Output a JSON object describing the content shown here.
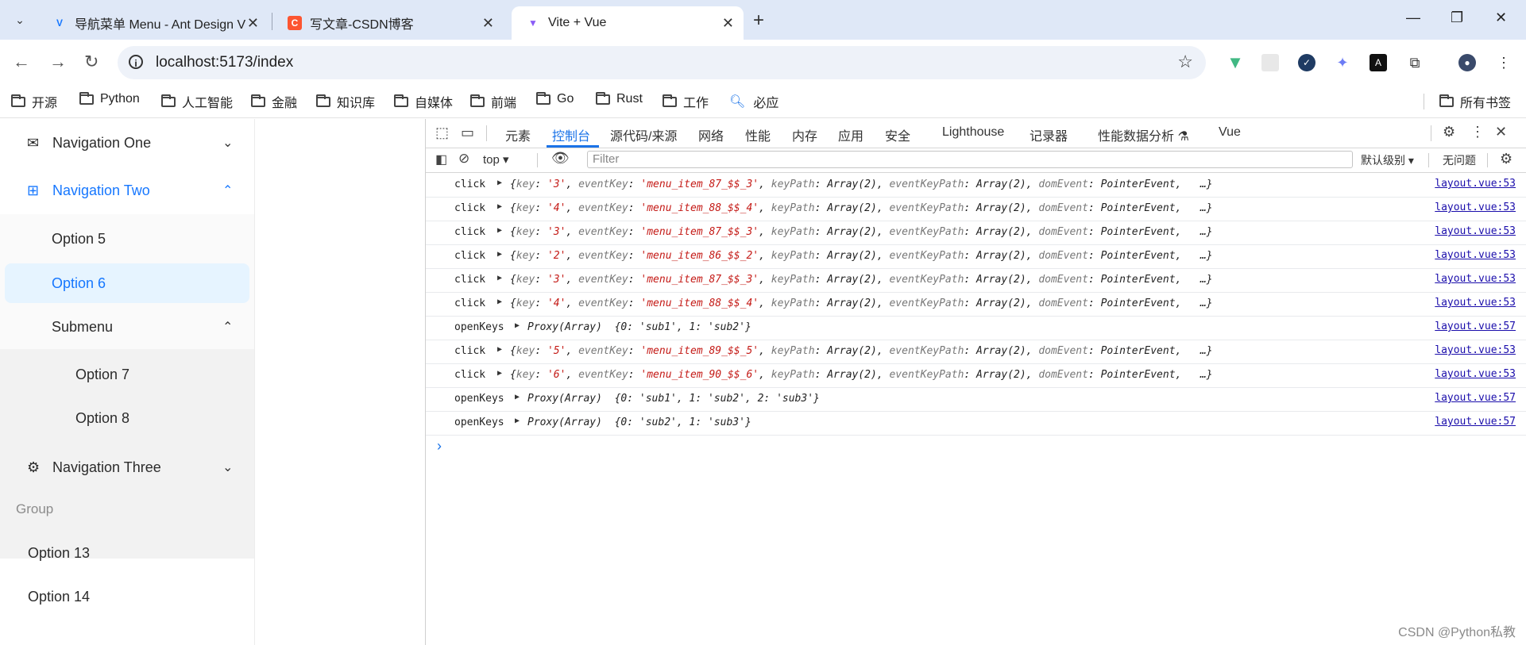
{
  "browser": {
    "tabs": [
      {
        "title": "导航菜单 Menu - Ant Design Vue",
        "active": false
      },
      {
        "title": "写文章-CSDN博客",
        "active": false
      },
      {
        "title": "Vite + Vue",
        "active": true
      }
    ],
    "url": "localhost:5173/index",
    "bookmarks": [
      "开源",
      "Python",
      "人工智能",
      "金融",
      "知识库",
      "自媒体",
      "前端",
      "Go",
      "Rust",
      "工作",
      "必应"
    ],
    "all_bookmarks": "所有书签"
  },
  "menu": {
    "nav_one": "Navigation One",
    "nav_two": "Navigation Two",
    "option5": "Option 5",
    "option6": "Option 6",
    "submenu": "Submenu",
    "option7": "Option 7",
    "option8": "Option 8",
    "nav_three": "Navigation Three",
    "group": "Group",
    "option13": "Option 13",
    "option14": "Option 14"
  },
  "devtools": {
    "tabs": [
      "元素",
      "控制台",
      "源代码/来源",
      "网络",
      "性能",
      "内存",
      "应用",
      "安全",
      "Lighthouse",
      "记录器",
      "性能数据分析 ⚗",
      "Vue"
    ],
    "active_tab": "控制台",
    "context": "top",
    "filter_placeholder": "Filter",
    "levels": "默认级别",
    "issues": "无问题",
    "logs": [
      {
        "kind": "click",
        "key": "'3'",
        "eventKey": "'menu_item_87_$$_3'",
        "src": "layout.vue:53"
      },
      {
        "kind": "click",
        "key": "'4'",
        "eventKey": "'menu_item_88_$$_4'",
        "src": "layout.vue:53"
      },
      {
        "kind": "click",
        "key": "'3'",
        "eventKey": "'menu_item_87_$$_3'",
        "src": "layout.vue:53"
      },
      {
        "kind": "click",
        "key": "'2'",
        "eventKey": "'menu_item_86_$$_2'",
        "src": "layout.vue:53"
      },
      {
        "kind": "click",
        "key": "'3'",
        "eventKey": "'menu_item_87_$$_3'",
        "src": "layout.vue:53"
      },
      {
        "kind": "click",
        "key": "'4'",
        "eventKey": "'menu_item_88_$$_4'",
        "src": "layout.vue:53"
      },
      {
        "kind": "openKeys",
        "proxy": "{0: 'sub1', 1: 'sub2'}",
        "src": "layout.vue:57"
      },
      {
        "kind": "click",
        "key": "'5'",
        "eventKey": "'menu_item_89_$$_5'",
        "src": "layout.vue:53"
      },
      {
        "kind": "click",
        "key": "'6'",
        "eventKey": "'menu_item_90_$$_6'",
        "src": "layout.vue:53"
      },
      {
        "kind": "openKeys",
        "proxy": "{0: 'sub1', 1: 'sub2', 2: 'sub3'}",
        "src": "layout.vue:57"
      },
      {
        "kind": "openKeys",
        "proxy": "{0: 'sub2', 1: 'sub3'}",
        "src": "layout.vue:57"
      }
    ]
  },
  "watermark": "CSDN @Python私教",
  "colors": {
    "accent": "#1677ff",
    "selected_bg": "#e6f4ff",
    "devtools_blue": "#1a73e8",
    "string_red": "#c41a16"
  }
}
